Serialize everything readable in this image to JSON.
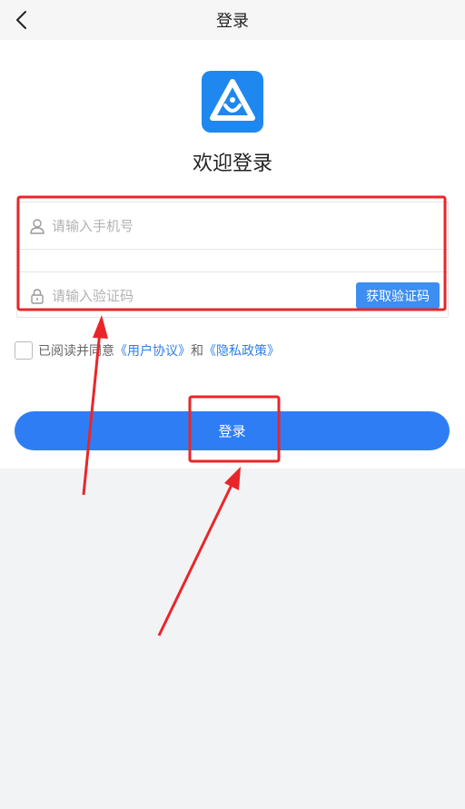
{
  "navbar": {
    "title": "登录",
    "back_icon": "chevron-left-icon"
  },
  "logo": {
    "icon": "app-logo-icon",
    "color": "#1e88f0"
  },
  "welcome": "欢迎登录",
  "form": {
    "phone_placeholder": "请输入手机号",
    "phone_value": "",
    "phone_icon": "user-icon",
    "code_placeholder": "请输入验证码",
    "code_value": "",
    "code_icon": "lock-icon",
    "get_code_label": "获取验证码"
  },
  "agreement": {
    "prefix": "已阅读并同意",
    "user_agreement": "《用户协议》",
    "and": "和",
    "privacy_policy": "《隐私政策》",
    "checked": false
  },
  "login_button": "登录",
  "colors": {
    "primary": "#2f7df4",
    "link": "#2f7fe8",
    "annotation": "#e8262a"
  }
}
